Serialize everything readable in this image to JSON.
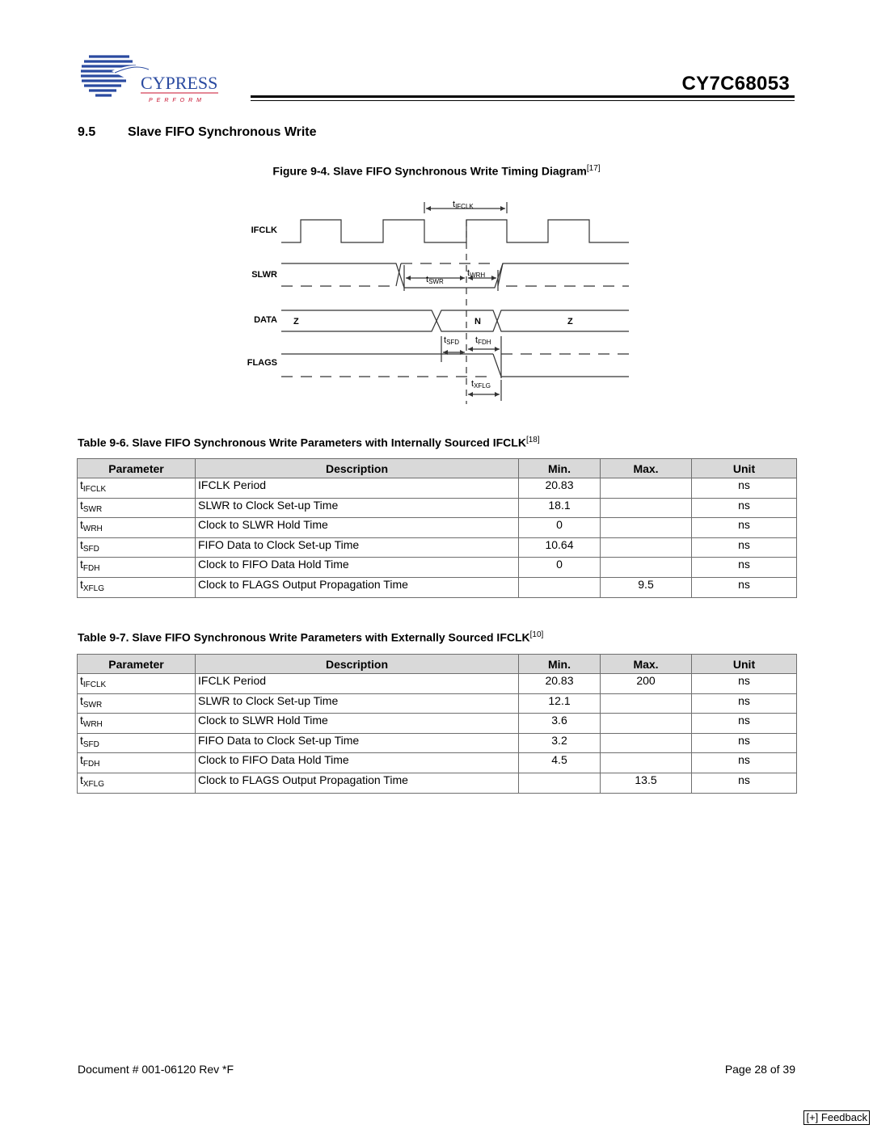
{
  "header": {
    "logo": {
      "brand": "CYPRESS",
      "tagline": "PERFORM",
      "colors": {
        "blue": "#2a4aa0",
        "red": "#c8102e"
      }
    },
    "part_number": "CY7C68053"
  },
  "section": {
    "number": "9.5",
    "title": "Slave FIFO Synchronous Write"
  },
  "figure": {
    "caption": "Figure 9-4. Slave FIFO Synchronous Write Timing Diagram",
    "ref": "[17]",
    "signals": [
      "IFCLK",
      "SLWR",
      "DATA",
      "FLAGS"
    ],
    "data_labels": {
      "before": "Z",
      "valid": "N",
      "after": "Z"
    },
    "timing_labels": {
      "ifclk": {
        "t": "t",
        "sub": "IFCLK"
      },
      "swr": {
        "t": "t",
        "sub": "SWR"
      },
      "wrh": {
        "t": "t",
        "sub": "WRH"
      },
      "sfd": {
        "t": "t",
        "sub": "SFD"
      },
      "fdh": {
        "t": "t",
        "sub": "FDH"
      },
      "xflg": {
        "t": "t",
        "sub": "XFLG"
      }
    }
  },
  "tables": [
    {
      "caption": "Table 9-6.  Slave FIFO Synchronous Write Parameters with Internally Sourced IFCLK",
      "ref": "[18]",
      "headers": [
        "Parameter",
        "Description",
        "Min.",
        "Max.",
        "Unit"
      ],
      "rows": [
        {
          "t": "t",
          "sub": "IFCLK",
          "desc": "IFCLK Period",
          "min": "20.83",
          "max": "",
          "unit": "ns"
        },
        {
          "t": "t",
          "sub": "SWR",
          "desc": "SLWR to Clock Set-up Time",
          "min": "18.1",
          "max": "",
          "unit": "ns"
        },
        {
          "t": "t",
          "sub": "WRH",
          "desc": "Clock to SLWR Hold Time",
          "min": "0",
          "max": "",
          "unit": "ns"
        },
        {
          "t": "t",
          "sub": "SFD",
          "desc": "FIFO Data to Clock Set-up Time",
          "min": "10.64",
          "max": "",
          "unit": "ns"
        },
        {
          "t": "t",
          "sub": "FDH",
          "desc": "Clock to FIFO Data Hold Time",
          "min": "0",
          "max": "",
          "unit": "ns"
        },
        {
          "t": "t",
          "sub": "XFLG",
          "desc": "Clock to FLAGS Output Propagation Time",
          "min": "",
          "max": "9.5",
          "unit": "ns"
        }
      ]
    },
    {
      "caption": "Table 9-7.  Slave FIFO Synchronous Write Parameters with Externally Sourced IFCLK",
      "ref": "[10]",
      "headers": [
        "Parameter",
        "Description",
        "Min.",
        "Max.",
        "Unit"
      ],
      "rows": [
        {
          "t": "t",
          "sub": "IFCLK",
          "desc": "IFCLK Period",
          "min": "20.83",
          "max": "200",
          "unit": "ns"
        },
        {
          "t": "t",
          "sub": "SWR",
          "desc": "SLWR to Clock Set-up Time",
          "min": "12.1",
          "max": "",
          "unit": "ns"
        },
        {
          "t": "t",
          "sub": "WRH",
          "desc": "Clock to SLWR Hold Time",
          "min": "3.6",
          "max": "",
          "unit": "ns"
        },
        {
          "t": "t",
          "sub": "SFD",
          "desc": "FIFO Data to Clock Set-up Time",
          "min": "3.2",
          "max": "",
          "unit": "ns"
        },
        {
          "t": "t",
          "sub": "FDH",
          "desc": "Clock to FIFO Data Hold Time",
          "min": "4.5",
          "max": "",
          "unit": "ns"
        },
        {
          "t": "t",
          "sub": "XFLG",
          "desc": "Clock to FLAGS Output Propagation Time",
          "min": "",
          "max": "13.5",
          "unit": "ns"
        }
      ]
    }
  ],
  "footer": {
    "document": "Document # 001-06120 Rev *F",
    "page": "Page 28 of 39",
    "feedback": "[+] Feedback"
  }
}
